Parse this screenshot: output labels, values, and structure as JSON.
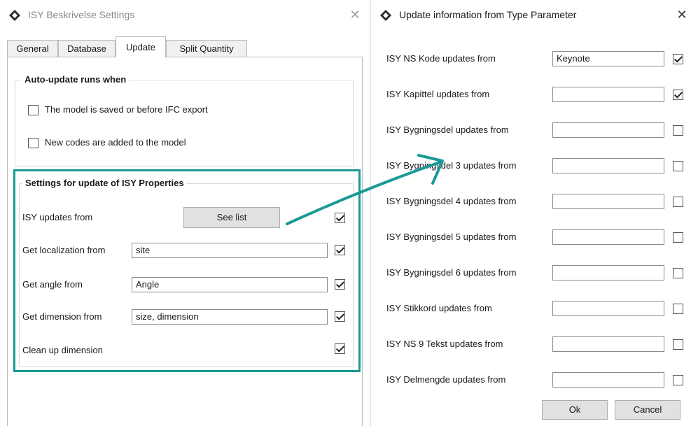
{
  "left_window": {
    "title": "ISY Beskrivelse Settings",
    "close": "✕",
    "tabs": [
      {
        "label": "General"
      },
      {
        "label": "Database"
      },
      {
        "label": "Update",
        "active": true
      },
      {
        "label": "Split Quantity"
      }
    ],
    "auto_update": {
      "title": "Auto-update runs when",
      "options": [
        {
          "label": "The model is saved or before IFC export",
          "checked": false
        },
        {
          "label": "New codes are added to the model",
          "checked": false
        }
      ]
    },
    "settings": {
      "title": "Settings for update of ISY Properties",
      "isy_updates_from": {
        "label": "ISY updates from",
        "button": "See list",
        "checked": true
      },
      "localization": {
        "label": "Get localization from",
        "value": "site",
        "checked": true
      },
      "angle": {
        "label": "Get angle from",
        "value": "Angle",
        "checked": true
      },
      "dimension": {
        "label": "Get dimension from",
        "value": "size, dimension",
        "checked": true
      },
      "clean_up": {
        "label": "Clean up dimension",
        "checked": true
      }
    }
  },
  "right_window": {
    "title": "Update information from Type Parameter",
    "close": "✕",
    "rows": [
      {
        "label": "ISY NS Kode updates from",
        "value": "Keynote",
        "checked": true
      },
      {
        "label": "ISY Kapittel updates from",
        "value": "",
        "checked": true
      },
      {
        "label": "ISY Bygningsdel updates from",
        "value": "",
        "checked": false
      },
      {
        "label": "ISY Bygningsdel 3 updates from",
        "value": "",
        "checked": false
      },
      {
        "label": "ISY Bygningsdel 4 updates from",
        "value": "",
        "checked": false
      },
      {
        "label": "ISY Bygningsdel 5 updates from",
        "value": "",
        "checked": false
      },
      {
        "label": "ISY Bygningsdel 6 updates from",
        "value": "",
        "checked": false
      },
      {
        "label": "ISY Stikkord updates from",
        "value": "",
        "checked": false
      },
      {
        "label": "ISY NS 9 Tekst updates from",
        "value": "",
        "checked": false
      },
      {
        "label": "ISY Delmengde updates from",
        "value": "",
        "checked": false
      }
    ],
    "ok_label": "Ok",
    "cancel_label": "Cancel"
  },
  "colors": {
    "highlight": "#1a9a94",
    "icon_dark": "#2b2b2b"
  }
}
